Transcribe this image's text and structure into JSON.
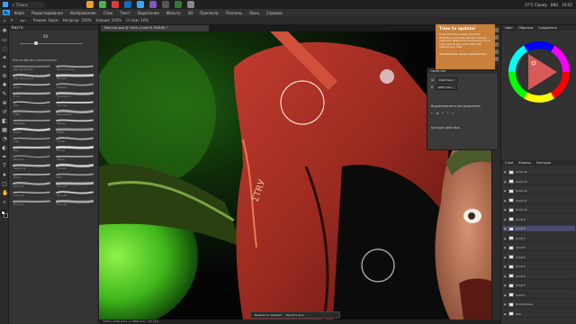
{
  "taskbar": {
    "search_label": "Поиск",
    "weather": "17°C Cloudy",
    "lang": "ENG",
    "time": "19:52",
    "date": "04.07.2024"
  },
  "menubar": {
    "logo": "Ps",
    "items": [
      "Файл",
      "Редактирование",
      "Изображение",
      "Слои",
      "Текст",
      "Выделение",
      "Фильтр",
      "3D",
      "Просмотр",
      "Плагины",
      "Окно",
      "Справка"
    ]
  },
  "optionsbar": {
    "values": [
      "50",
      "Режим: Норм",
      "Непрозр: 100%",
      "Нажим: 100%",
      "Сглаж: 10%"
    ]
  },
  "brush_panel": {
    "title": "Кисти",
    "size_value": "50",
    "group_name": "Кисти общего назначения",
    "presets": [
      "Круглая жесткая",
      "Мягкая круглая",
      "Жесткая круглая",
      "Пастель",
      "Масло",
      "Акварель",
      "Уголь",
      "Сухая кисть",
      "Мел",
      "Текстура",
      "Губка",
      "Шероховатая",
      "Карандаш",
      "Маркер",
      "Спрей",
      "Штрих",
      "Тушь",
      "Грубая",
      "Перо",
      "Мягкая",
      "Широкая",
      "Рваная",
      "Зернистая",
      "Плоская",
      "Мазок",
      "Ворс",
      "Кисть 27",
      "Кисть 28",
      "Кисть 29",
      "Кисть 30",
      "Кисть 31",
      "Кисть 32"
    ]
  },
  "document": {
    "tab_title": "Монтаж.psd @ 100% (Слой 8, RGB/8) *",
    "status": "100%  |  1920 пикс. x 1080 пикс. (72 ppi)"
  },
  "notification": {
    "title": "Time to update!",
    "body": "It has been five weeks since this Photoshop build was released. Please install the latest build via Creative Cloud in the app to stay up to date with features and fixes.",
    "link": "See Photoshop release notes  Dismiss"
  },
  "properties_panel": {
    "title": "Свойства",
    "w_label": "Ш",
    "w_value": "1920 пикс.",
    "h_label": "В",
    "h_value": "1080 пикс.",
    "section1": "Выравнивание и распределение",
    "section2": "Быстрые действия"
  },
  "right_panels": {
    "tabs": [
      "Цвет",
      "Образцы",
      "Градиенты"
    ],
    "layers_tabs": [
      "Слои",
      "Каналы",
      "Контуры"
    ],
    "layers": [
      "Слой 14",
      "Слой 13",
      "Слой 12",
      "Слой 11",
      "Слой 10",
      "Слой 9",
      "Слой 8",
      "Слой 7",
      "Слой 6",
      "Слой 5",
      "Слой 4",
      "Слой 3",
      "Слой 2",
      "Слой 1",
      "Копия фона",
      "Фон"
    ]
  },
  "context_bar": {
    "items": [
      "Выделить предмет",
      "Удалить фон"
    ]
  },
  "colors": {
    "ps_blue": "#31a8ff",
    "notification": "#c8803a",
    "active_layer": "#4b4b6e"
  }
}
